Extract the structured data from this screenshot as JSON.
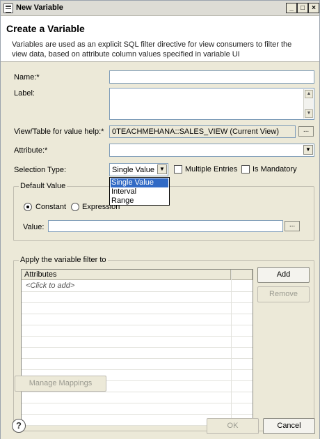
{
  "window": {
    "title": "New Variable"
  },
  "header": {
    "title": "Create a Variable",
    "description": "Variables are used as an explicit SQL filter directive for view consumers to filter the view data, based on attribute column values specified in variable UI"
  },
  "form": {
    "name_label": "Name:*",
    "name_value": "",
    "label_label": "Label:",
    "label_value": "",
    "view_table_label": "View/Table for value help:*",
    "view_table_value": "0TEACHMEHANA::SALES_VIEW (Current View)",
    "attribute_label": "Attribute:*",
    "attribute_value": "",
    "selection_type_label": "Selection Type:",
    "selection_type_value": "Single Value",
    "selection_type_options": [
      "Single Value",
      "Interval",
      "Range"
    ],
    "multiple_entries_label": "Multiple Entries",
    "is_mandatory_label": "Is Mandatory"
  },
  "default_value": {
    "group_title": "Default Value",
    "constant_label": "Constant",
    "expression_label": "Expression",
    "value_label": "Value:",
    "value": ""
  },
  "filter": {
    "group_title": "Apply the variable filter to",
    "columns": [
      "Attributes",
      ""
    ],
    "placeholder_row": "<Click to add>",
    "add_label": "Add",
    "remove_label": "Remove"
  },
  "manage_mappings_label": "Manage Mappings",
  "footer": {
    "ok_label": "OK",
    "cancel_label": "Cancel",
    "help_icon_glyph": "?"
  },
  "icons": {
    "ellipsis": "...",
    "chevron_down": "▼",
    "chevron_up": "▲",
    "minimize": "_",
    "maximize": "□",
    "close": "×"
  }
}
